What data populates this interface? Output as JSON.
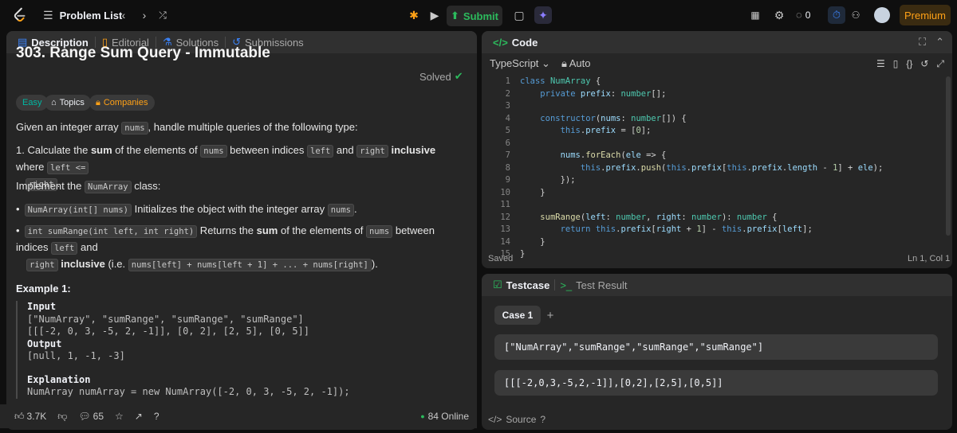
{
  "nav": {
    "problem_list": "Problem List",
    "submit": "Submit",
    "streak_count": "0",
    "premium": "Premium"
  },
  "description": {
    "tabs": [
      "Description",
      "Editorial",
      "Solutions",
      "Submissions"
    ],
    "title": "303. Range Sum Query - Immutable",
    "solved": "Solved",
    "chips": [
      "Easy",
      "Topics",
      "Companies"
    ],
    "intro_pre": "Given an integer array ",
    "intro_code": "nums",
    "intro_post": ", handle multiple queries of the following type:",
    "item1_pre": "1. Calculate the ",
    "item1_sum": "sum",
    "item1_mid": " of the elements of ",
    "item1_code1": "nums",
    "item1_mid2": " between indices ",
    "item1_code2": "left",
    "item1_and": " and ",
    "item1_code3": "right",
    "item1_incl": " inclusive",
    "item1_where": " where ",
    "item1_code4": "left <=",
    "item1_code5": "right",
    "item1_end": ".",
    "implement_pre": "Implement the ",
    "implement_code": "NumArray",
    "implement_post": " class:",
    "bullet1_code": "NumArray(int[] nums)",
    "bullet1_text": " Initializes the object with the integer array ",
    "bullet1_code2": "nums",
    "bullet1_end": ".",
    "bullet2_code": "int sumRange(int left, int right)",
    "bullet2_text1": " Returns the ",
    "bullet2_sum": "sum",
    "bullet2_text2": " of the elements of ",
    "bullet2_code2": "nums",
    "bullet2_text3": " between indices ",
    "bullet2_code3": "left",
    "bullet2_and": " and",
    "bullet2_code4": "right",
    "bullet2_incl": " inclusive",
    "bullet2_ie": " (i.e. ",
    "bullet2_code5": "nums[left] + nums[left + 1] + ... + nums[right]",
    "bullet2_end": ").",
    "example_title": "Example 1:",
    "example_input_label": "Input",
    "example_input1": "[\"NumArray\", \"sumRange\", \"sumRange\", \"sumRange\"]",
    "example_input2": "[[[-2, 0, 3, -5, 2, -1]], [0, 2], [2, 5], [0, 5]]",
    "example_output_label": "Output",
    "example_output": "[null, 1, -1, -3]",
    "explanation_label": "Explanation",
    "explanation_line": "NumArray numArray = new NumArray([-2, 0, 3, -5, 2, -1]);",
    "likes": "3.7K",
    "comments": "65",
    "online": "84 Online"
  },
  "code": {
    "header": "Code",
    "language": "TypeScript",
    "mode": "Auto",
    "saved": "Saved",
    "cursor": "Ln 1, Col 1",
    "lines": [
      "class NumArray {",
      "    private prefix: number[];",
      "",
      "    constructor(nums: number[]) {",
      "        this.prefix = [0];",
      "",
      "        nums.forEach(ele => {",
      "            this.prefix.push(this.prefix[this.prefix.length - 1] + ele);",
      "        });",
      "    }",
      "",
      "    sumRange(left: number, right: number): number {",
      "        return this.prefix[right + 1] - this.prefix[left];",
      "    }",
      "}"
    ]
  },
  "testcase": {
    "tabs": [
      "Testcase",
      "Test Result"
    ],
    "case": "Case 1",
    "add": "+",
    "input1": "[\"NumArray\",\"sumRange\",\"sumRange\",\"sumRange\"]",
    "input2": "[[[-2,0,3,-5,2,-1]],[0,2],[2,5],[0,5]]",
    "source": "Source"
  }
}
